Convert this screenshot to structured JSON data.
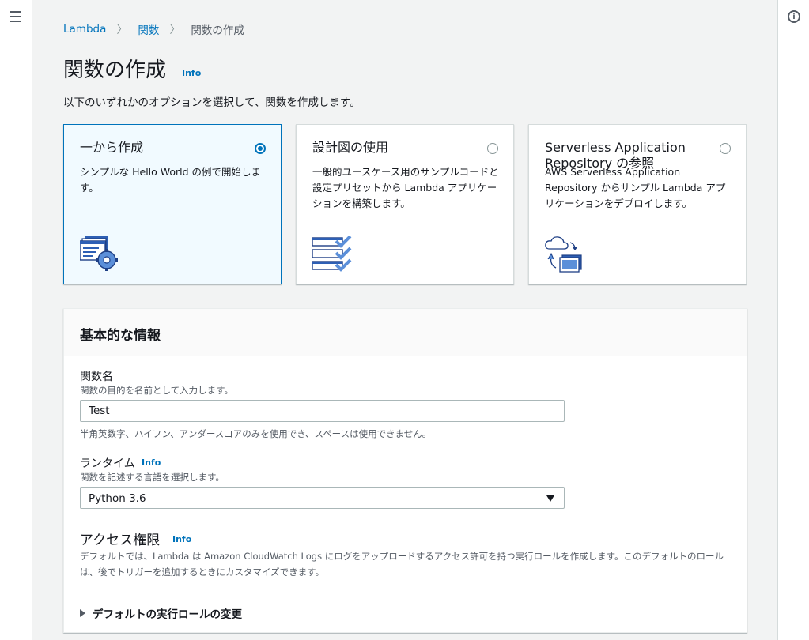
{
  "breadcrumb": {
    "root": "Lambda",
    "functions": "関数",
    "current": "関数の作成"
  },
  "page": {
    "title": "関数の作成",
    "info": "Info",
    "description": "以下のいずれかのオプションを選択して、関数を作成します。"
  },
  "options": [
    {
      "title": "一から作成",
      "description": "シンプルな Hello World の例で開始します。",
      "selected": true,
      "icon": "code-window-gear-icon"
    },
    {
      "title": "設計図の使用",
      "description": "一般的ユースケース用のサンプルコードと設定プリセットから Lambda アプリケーションを構築します。",
      "selected": false,
      "icon": "blueprint-checklist-icon"
    },
    {
      "title": "Serverless Application Repository の参照",
      "description": "AWS Serverless Application Repository からサンプル Lambda アプリケーションをデプロイします。",
      "selected": false,
      "icon": "cloud-deploy-icon"
    }
  ],
  "basic_info": {
    "title": "基本的な情報",
    "function_name": {
      "label": "関数名",
      "hint": "関数の目的を名前として入力します。",
      "value": "Test",
      "constraint": "半角英数字、ハイフン、アンダースコアのみを使用でき、スペースは使用できません。"
    },
    "runtime": {
      "label": "ランタイム",
      "info": "Info",
      "hint": "関数を記述する言語を選択します。",
      "value": "Python 3.6"
    },
    "permissions": {
      "title": "アクセス権限",
      "info": "Info",
      "description": "デフォルトでは、Lambda は Amazon CloudWatch Logs にログをアップロードするアクセス許可を持つ実行ロールを作成します。このデフォルトのロールは、後でトリガーを追加するときにカスタマイズできます。",
      "expander": "デフォルトの実行ロールの変更"
    }
  },
  "colors": {
    "accent": "#0073bb",
    "selected_bg": "#f1faff",
    "page_bg": "#f2f3f3"
  }
}
